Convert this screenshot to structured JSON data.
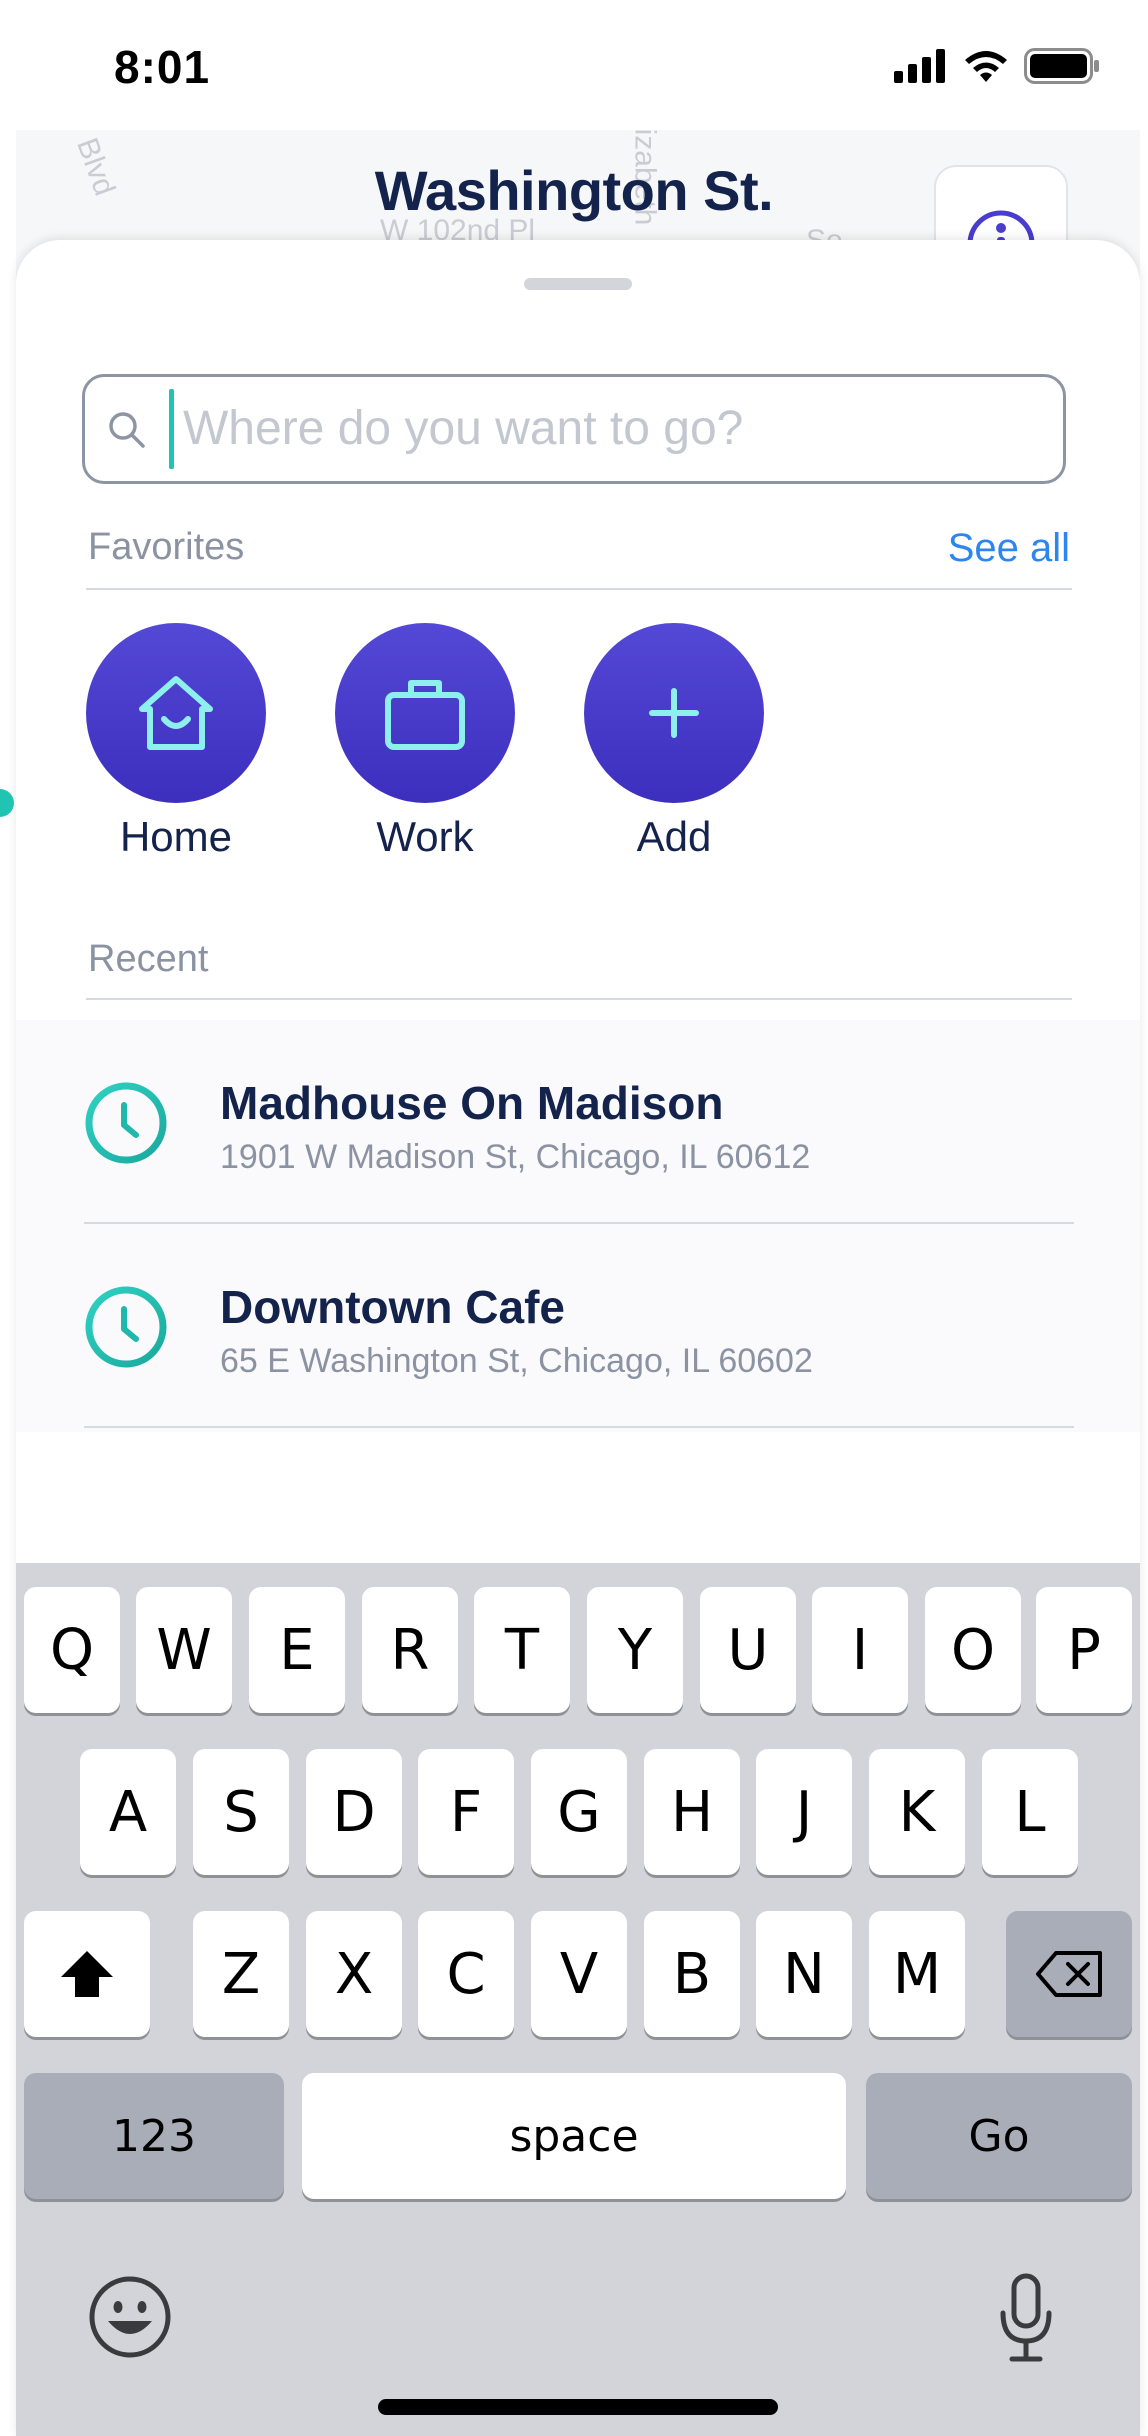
{
  "status": {
    "time": "8:01"
  },
  "map": {
    "title": "Washington St.",
    "streets": [
      "Blvd",
      "W 102nd Pl",
      "izabeth",
      "So"
    ]
  },
  "search": {
    "placeholder": "Where do you want to go?"
  },
  "favorites": {
    "title": "Favorites",
    "see_all": "See all",
    "items": [
      {
        "label": "Home",
        "icon": "home-icon"
      },
      {
        "label": "Work",
        "icon": "briefcase-icon"
      },
      {
        "label": "Add",
        "icon": "plus-icon"
      }
    ]
  },
  "recent": {
    "title": "Recent",
    "items": [
      {
        "name": "Madhouse On Madison",
        "address": "1901 W Madison St, Chicago, IL 60612"
      },
      {
        "name": "Downtown Cafe",
        "address": "65 E Washington St, Chicago, IL 60602"
      }
    ]
  },
  "keyboard": {
    "row1": [
      "Q",
      "W",
      "E",
      "R",
      "T",
      "Y",
      "U",
      "I",
      "O",
      "P"
    ],
    "row2": [
      "A",
      "S",
      "D",
      "F",
      "G",
      "H",
      "J",
      "K",
      "L"
    ],
    "row3": [
      "Z",
      "X",
      "C",
      "V",
      "B",
      "N",
      "M"
    ],
    "numbers": "123",
    "space": "space",
    "go": "Go"
  },
  "colors": {
    "accent": "#21c4b2",
    "brand_purple": "#4a3ccc",
    "link_blue": "#2d86f0",
    "title_navy": "#14234b"
  }
}
